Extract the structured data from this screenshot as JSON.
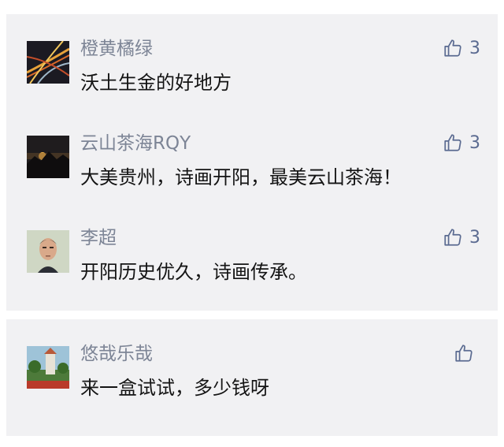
{
  "comments_top": [
    {
      "author": "橙黄橘绿",
      "text": "沃土生金的好地方",
      "likes": "3",
      "avatar": "highway-night-avatar"
    },
    {
      "author": "云山茶海RQY",
      "text": "大美贵州，诗画开阳，最美云山茶海！",
      "likes": "3",
      "avatar": "sunset-landscape-avatar"
    },
    {
      "author": "李超",
      "text": "开阳历史优久，诗画传承。",
      "likes": "3",
      "avatar": "portrait-avatar"
    }
  ],
  "comments_bottom": [
    {
      "author": "悠哉乐哉",
      "text": "来一盒试试，多少钱呀",
      "likes": "",
      "avatar": "garden-building-avatar"
    }
  ],
  "colors": {
    "card_background": "#f1f1f3",
    "author_name": "#7d8596",
    "comment_text": "#141414",
    "like_icon": "#5b6b91"
  },
  "icons": {
    "like": "thumbs-up-icon"
  }
}
